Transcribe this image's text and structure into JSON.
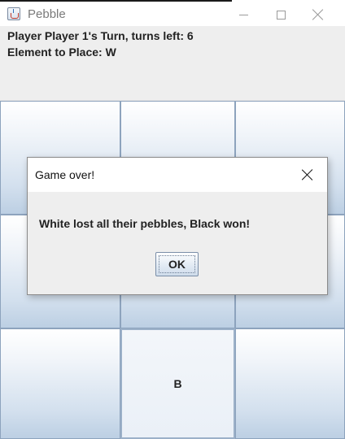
{
  "window": {
    "title": "Pebble",
    "icon": "java-cup-icon"
  },
  "status": {
    "turn_line": "Player Player 1's Turn, turns left: 6",
    "element_line": "Element to Place: W"
  },
  "board": {
    "rows": 3,
    "cols": 3,
    "cells": [
      "",
      "",
      "",
      "",
      "",
      "",
      "",
      "B",
      ""
    ]
  },
  "dialog": {
    "title": "Game over!",
    "message": "White lost all their pebbles, Black won!",
    "ok_label": "OK"
  },
  "colors": {
    "cell_border": "#8da3bd",
    "cell_gradient_bottom": "#bccfe3",
    "dialog_bg": "#eeeeee"
  }
}
